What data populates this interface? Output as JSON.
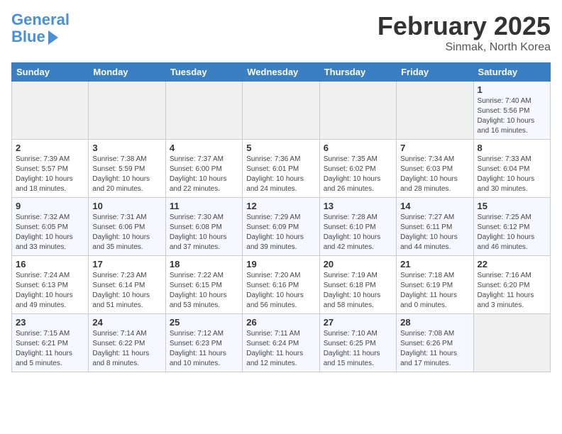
{
  "header": {
    "logo_line1": "General",
    "logo_line2": "Blue",
    "month": "February 2025",
    "location": "Sinmak, North Korea"
  },
  "days_of_week": [
    "Sunday",
    "Monday",
    "Tuesday",
    "Wednesday",
    "Thursday",
    "Friday",
    "Saturday"
  ],
  "weeks": [
    [
      {
        "day": "",
        "info": ""
      },
      {
        "day": "",
        "info": ""
      },
      {
        "day": "",
        "info": ""
      },
      {
        "day": "",
        "info": ""
      },
      {
        "day": "",
        "info": ""
      },
      {
        "day": "",
        "info": ""
      },
      {
        "day": "1",
        "info": "Sunrise: 7:40 AM\nSunset: 5:56 PM\nDaylight: 10 hours and 16 minutes."
      }
    ],
    [
      {
        "day": "2",
        "info": "Sunrise: 7:39 AM\nSunset: 5:57 PM\nDaylight: 10 hours and 18 minutes."
      },
      {
        "day": "3",
        "info": "Sunrise: 7:38 AM\nSunset: 5:59 PM\nDaylight: 10 hours and 20 minutes."
      },
      {
        "day": "4",
        "info": "Sunrise: 7:37 AM\nSunset: 6:00 PM\nDaylight: 10 hours and 22 minutes."
      },
      {
        "day": "5",
        "info": "Sunrise: 7:36 AM\nSunset: 6:01 PM\nDaylight: 10 hours and 24 minutes."
      },
      {
        "day": "6",
        "info": "Sunrise: 7:35 AM\nSunset: 6:02 PM\nDaylight: 10 hours and 26 minutes."
      },
      {
        "day": "7",
        "info": "Sunrise: 7:34 AM\nSunset: 6:03 PM\nDaylight: 10 hours and 28 minutes."
      },
      {
        "day": "8",
        "info": "Sunrise: 7:33 AM\nSunset: 6:04 PM\nDaylight: 10 hours and 30 minutes."
      }
    ],
    [
      {
        "day": "9",
        "info": "Sunrise: 7:32 AM\nSunset: 6:05 PM\nDaylight: 10 hours and 33 minutes."
      },
      {
        "day": "10",
        "info": "Sunrise: 7:31 AM\nSunset: 6:06 PM\nDaylight: 10 hours and 35 minutes."
      },
      {
        "day": "11",
        "info": "Sunrise: 7:30 AM\nSunset: 6:08 PM\nDaylight: 10 hours and 37 minutes."
      },
      {
        "day": "12",
        "info": "Sunrise: 7:29 AM\nSunset: 6:09 PM\nDaylight: 10 hours and 39 minutes."
      },
      {
        "day": "13",
        "info": "Sunrise: 7:28 AM\nSunset: 6:10 PM\nDaylight: 10 hours and 42 minutes."
      },
      {
        "day": "14",
        "info": "Sunrise: 7:27 AM\nSunset: 6:11 PM\nDaylight: 10 hours and 44 minutes."
      },
      {
        "day": "15",
        "info": "Sunrise: 7:25 AM\nSunset: 6:12 PM\nDaylight: 10 hours and 46 minutes."
      }
    ],
    [
      {
        "day": "16",
        "info": "Sunrise: 7:24 AM\nSunset: 6:13 PM\nDaylight: 10 hours and 49 minutes."
      },
      {
        "day": "17",
        "info": "Sunrise: 7:23 AM\nSunset: 6:14 PM\nDaylight: 10 hours and 51 minutes."
      },
      {
        "day": "18",
        "info": "Sunrise: 7:22 AM\nSunset: 6:15 PM\nDaylight: 10 hours and 53 minutes."
      },
      {
        "day": "19",
        "info": "Sunrise: 7:20 AM\nSunset: 6:16 PM\nDaylight: 10 hours and 56 minutes."
      },
      {
        "day": "20",
        "info": "Sunrise: 7:19 AM\nSunset: 6:18 PM\nDaylight: 10 hours and 58 minutes."
      },
      {
        "day": "21",
        "info": "Sunrise: 7:18 AM\nSunset: 6:19 PM\nDaylight: 11 hours and 0 minutes."
      },
      {
        "day": "22",
        "info": "Sunrise: 7:16 AM\nSunset: 6:20 PM\nDaylight: 11 hours and 3 minutes."
      }
    ],
    [
      {
        "day": "23",
        "info": "Sunrise: 7:15 AM\nSunset: 6:21 PM\nDaylight: 11 hours and 5 minutes."
      },
      {
        "day": "24",
        "info": "Sunrise: 7:14 AM\nSunset: 6:22 PM\nDaylight: 11 hours and 8 minutes."
      },
      {
        "day": "25",
        "info": "Sunrise: 7:12 AM\nSunset: 6:23 PM\nDaylight: 11 hours and 10 minutes."
      },
      {
        "day": "26",
        "info": "Sunrise: 7:11 AM\nSunset: 6:24 PM\nDaylight: 11 hours and 12 minutes."
      },
      {
        "day": "27",
        "info": "Sunrise: 7:10 AM\nSunset: 6:25 PM\nDaylight: 11 hours and 15 minutes."
      },
      {
        "day": "28",
        "info": "Sunrise: 7:08 AM\nSunset: 6:26 PM\nDaylight: 11 hours and 17 minutes."
      },
      {
        "day": "",
        "info": ""
      }
    ]
  ]
}
